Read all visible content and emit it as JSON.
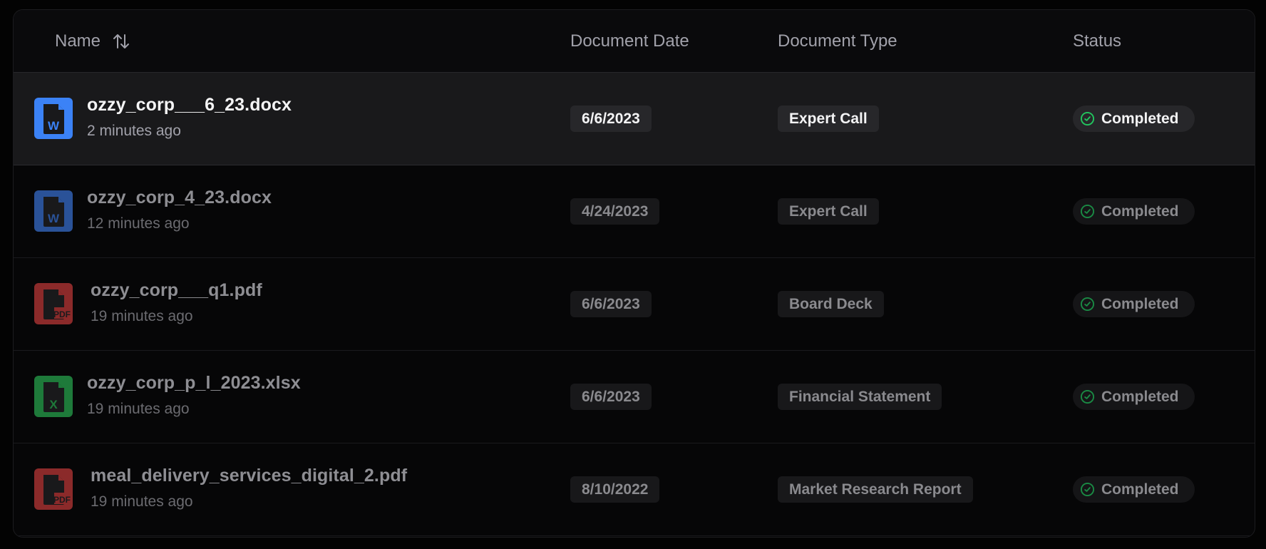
{
  "table": {
    "columns": {
      "name": "Name",
      "document_date": "Document Date",
      "document_type": "Document Type",
      "status": "Status"
    },
    "sort_icon": "sort-arrows-icon",
    "rows": [
      {
        "file_name": "ozzy_corp___6_23.docx",
        "uploaded": "2 minutes ago",
        "file_type": "docx",
        "icon": "word-file-icon",
        "document_date": "6/6/2023",
        "document_type": "Expert Call",
        "status": "Completed",
        "selected": true
      },
      {
        "file_name": "ozzy_corp_4_23.docx",
        "uploaded": "12 minutes ago",
        "file_type": "docx",
        "icon": "word-file-icon",
        "document_date": "4/24/2023",
        "document_type": "Expert Call",
        "status": "Completed",
        "selected": false
      },
      {
        "file_name": "ozzy_corp___q1.pdf",
        "uploaded": "19 minutes ago",
        "file_type": "pdf",
        "icon": "pdf-file-icon",
        "document_date": "6/6/2023",
        "document_type": "Board Deck",
        "status": "Completed",
        "selected": false
      },
      {
        "file_name": "ozzy_corp_p_l_2023.xlsx",
        "uploaded": "19 minutes ago",
        "file_type": "xlsx",
        "icon": "excel-file-icon",
        "document_date": "6/6/2023",
        "document_type": "Financial Statement",
        "status": "Completed",
        "selected": false
      },
      {
        "file_name": "meal_delivery_services_digital_2.pdf",
        "uploaded": "19 minutes ago",
        "file_type": "pdf",
        "icon": "pdf-file-icon",
        "document_date": "8/10/2022",
        "document_type": "Market Research Report",
        "status": "Completed",
        "selected": false
      }
    ]
  },
  "colors": {
    "word": "#3b82f6",
    "word_dim": "#2a5298",
    "pdf": "#8b2a2a",
    "excel": "#1e7a3a",
    "status_completed": "#22c55e",
    "status_completed_dim": "#1a8a44"
  }
}
